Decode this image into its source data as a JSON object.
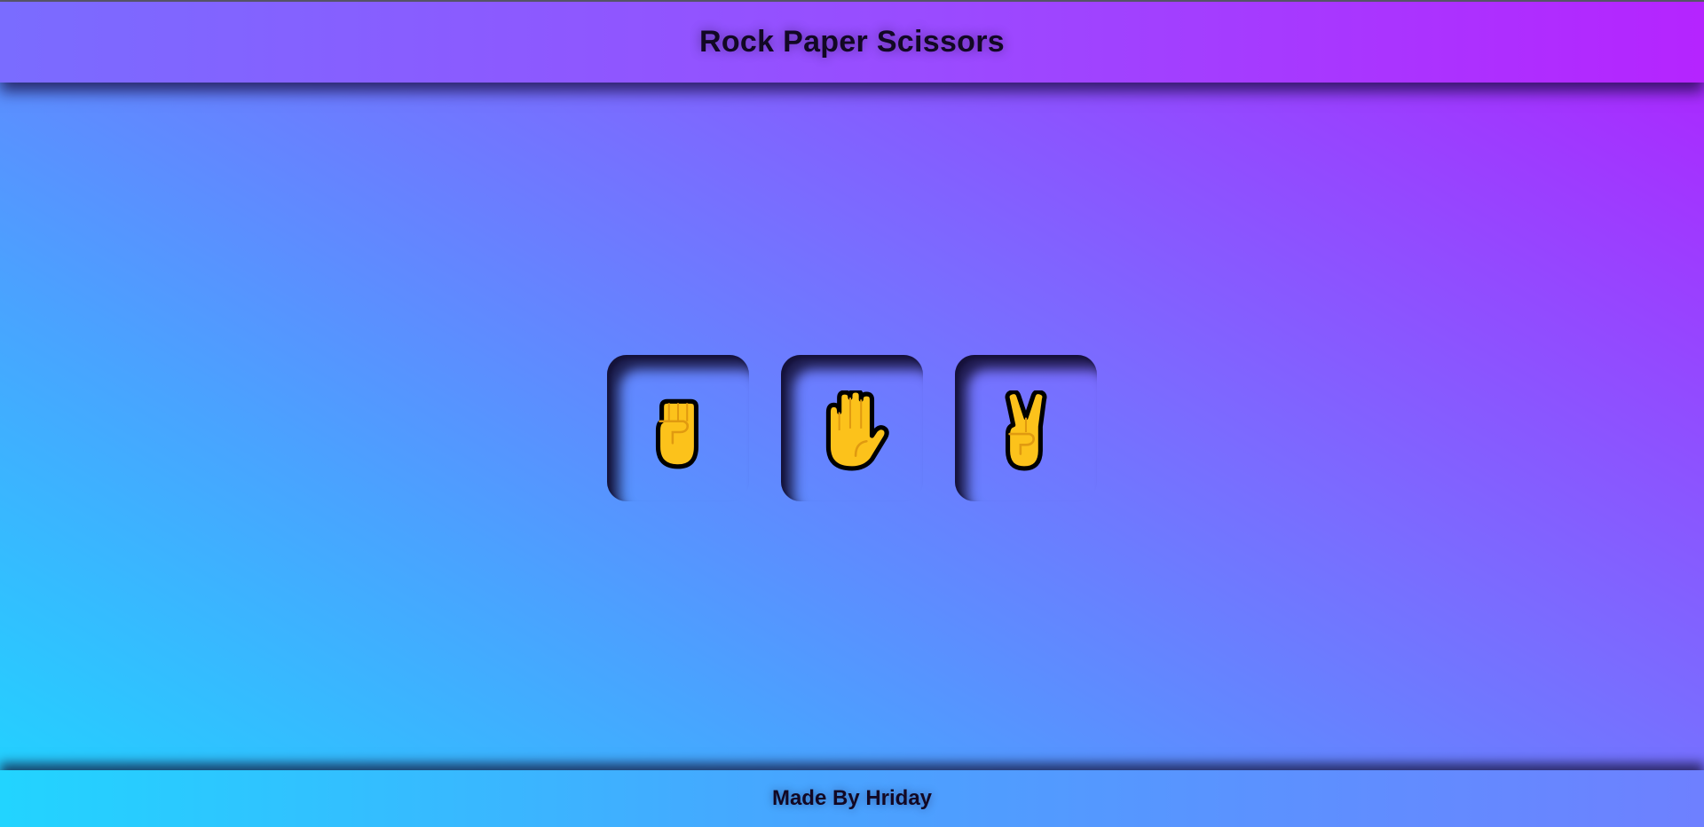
{
  "header": {
    "title": "Rock Paper Scissors"
  },
  "choices": [
    {
      "id": "rock",
      "icon": "raised-fist-icon"
    },
    {
      "id": "paper",
      "icon": "raised-hand-icon"
    },
    {
      "id": "scissors",
      "icon": "victory-hand-icon"
    }
  ],
  "footer": {
    "credit": "Made By Hriday"
  },
  "colors": {
    "gradient_start": "#1fd6ff",
    "gradient_end": "#b021ff",
    "text": "#120824",
    "hand_fill": "#fcc21b",
    "hand_outline": "#000000"
  }
}
